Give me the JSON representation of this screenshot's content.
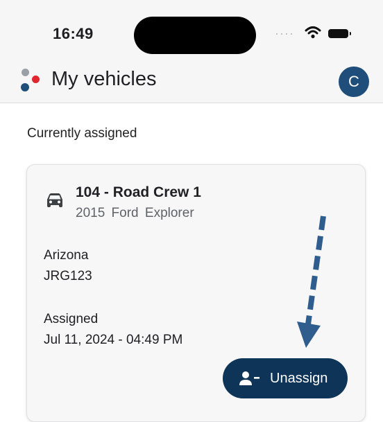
{
  "status_bar": {
    "time": "16:49"
  },
  "header": {
    "title": "My vehicles",
    "avatar_initial": "C"
  },
  "section": {
    "title": "Currently assigned"
  },
  "vehicle": {
    "name": "104 - Road Crew 1",
    "model": "2015 Ford Explorer",
    "state": "Arizona",
    "plate": "JRG123",
    "assigned_label": "Assigned",
    "assigned_date": "Jul 11, 2024 - 04:49 PM"
  },
  "actions": {
    "unassign_label": "Unassign"
  },
  "colors": {
    "accent": "#0e3558",
    "avatar": "#1f4e7a",
    "logo_red": "#e0262e",
    "logo_blue": "#1f4e7a",
    "logo_gray": "#9aa0a6"
  }
}
